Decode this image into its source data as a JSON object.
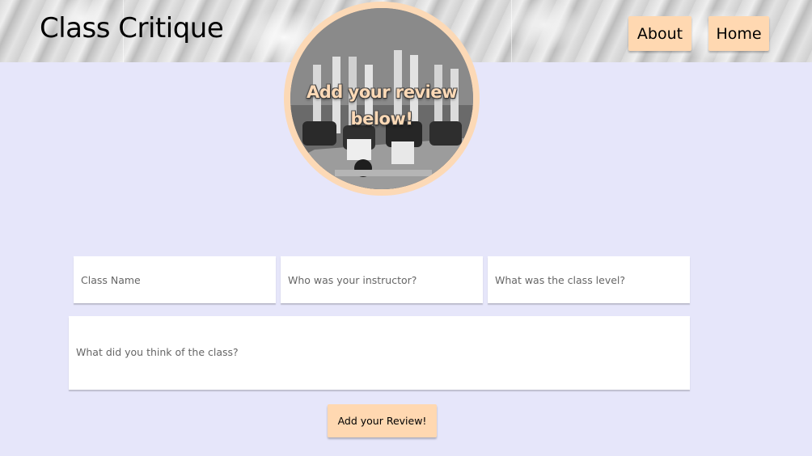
{
  "header": {
    "title": "Class Critique",
    "nav": {
      "about_label": "About",
      "home_label": "Home"
    }
  },
  "hero": {
    "caption": "Add your review below!"
  },
  "form": {
    "class_name_placeholder": "Class Name",
    "instructor_placeholder": "Who was your instructor?",
    "level_placeholder": "What was the class level?",
    "review_placeholder": "What did you think of the class?",
    "submit_label": "Add your Review!"
  },
  "colors": {
    "page_background": "#e6e6fa",
    "accent_peach": "#ffd8b1"
  }
}
